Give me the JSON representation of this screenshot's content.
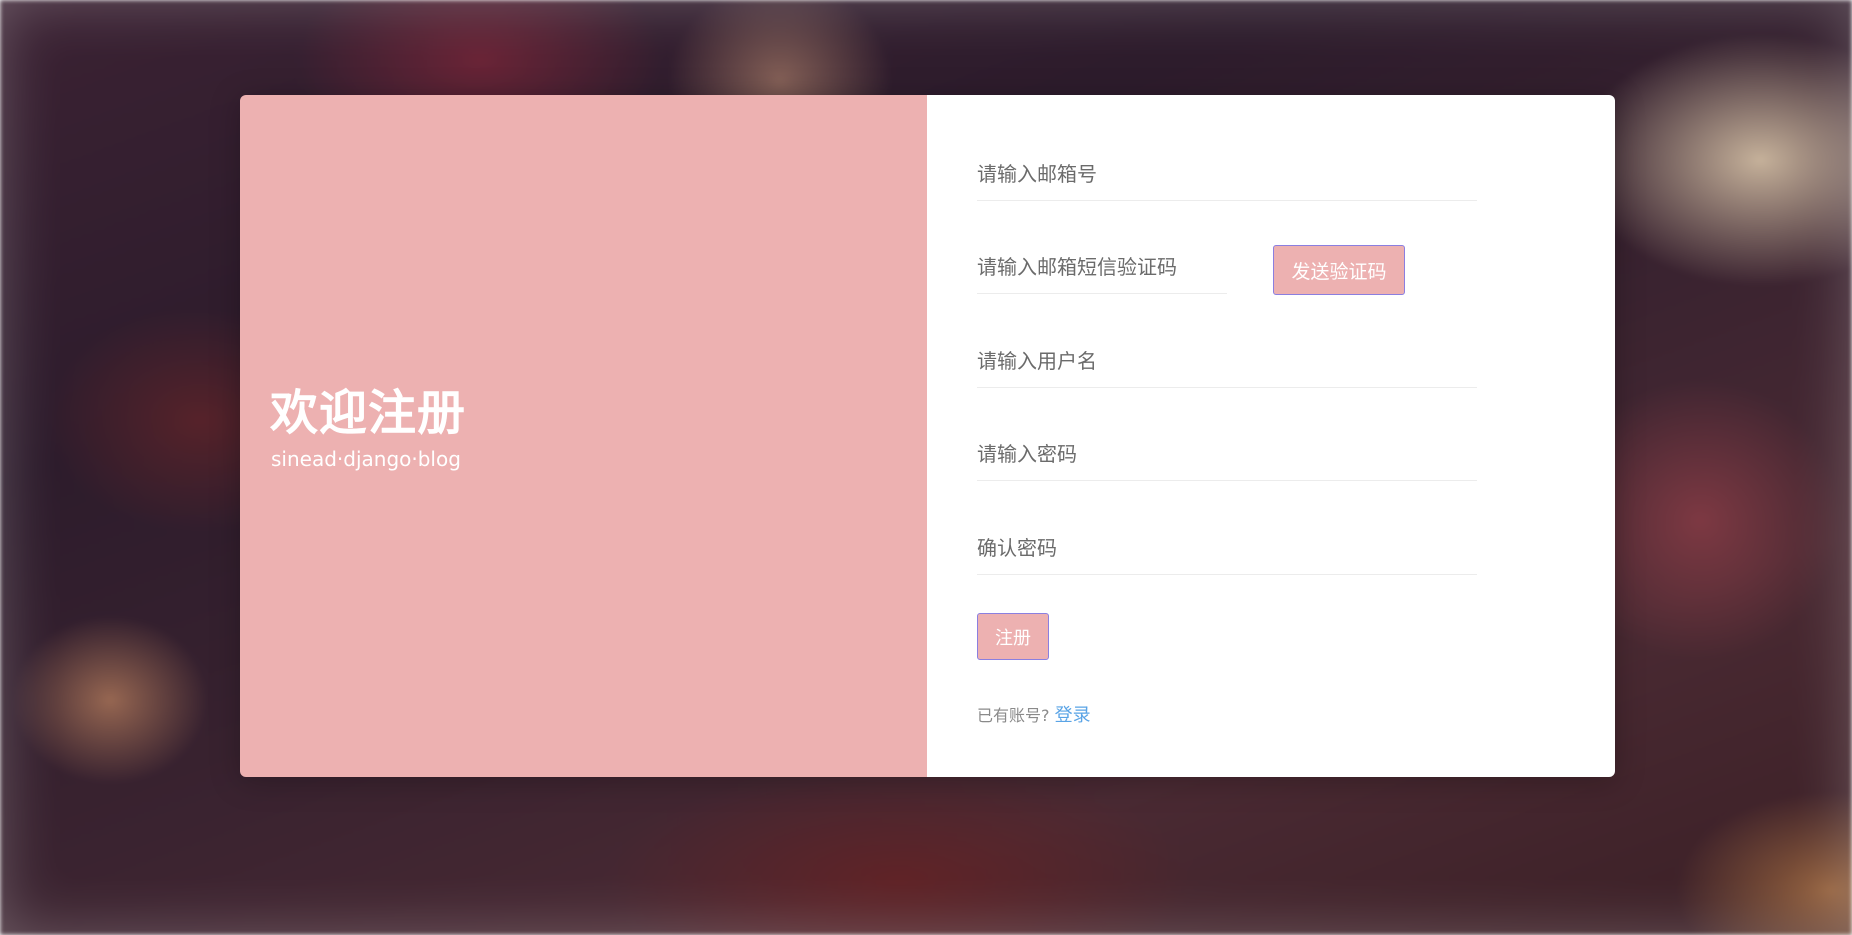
{
  "brand": {
    "title": "欢迎注册",
    "subtitle": "sinead·django·blog"
  },
  "form": {
    "email_placeholder": "请输入邮箱号",
    "code_placeholder": "请输入邮箱短信验证码",
    "send_code_label": "发送验证码",
    "username_placeholder": "请输入用户名",
    "password_placeholder": "请输入密码",
    "confirm_placeholder": "确认密码",
    "register_label": "注册",
    "has_account_text": "已有账号?",
    "login_label": "登录"
  },
  "colors": {
    "accent_pink": "#edb1b1",
    "link_blue": "#5aa4e6",
    "button_border": "#8b7fe0"
  }
}
